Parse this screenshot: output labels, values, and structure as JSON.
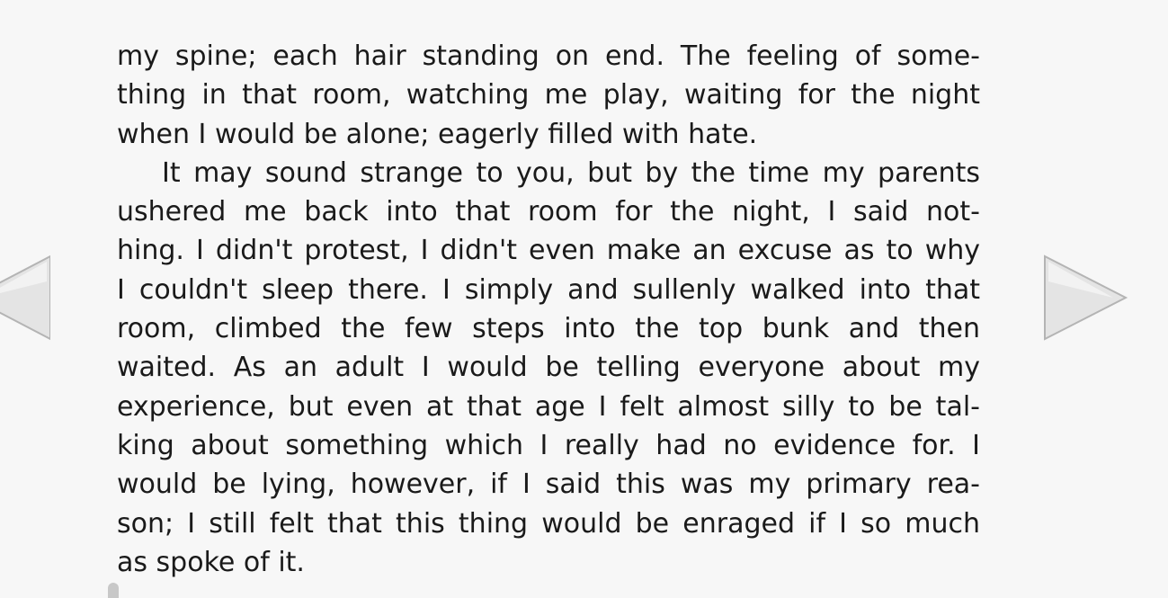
{
  "page": {
    "lines": [
      "my spine; each hair standing on end. The feeling of some-",
      "thing in that room, watching me play, waiting for the night",
      "when I would be alone; eagerly filled with hate.",
      "It may sound strange to you, but by the time my parents",
      "ushered me back into that room for the night, I said not-",
      "hing. I didn't protest, I didn't even make an excuse as to why",
      "I couldn't sleep there. I simply and sullenly walked into that",
      "room, climbed the few steps into the top bunk and then",
      "waited. As an adult I would be telling everyone about my",
      "experience, but even at that age I felt almost silly to be tal-",
      "king about something which I really had no evidence for. I",
      "would be lying, however, if I said this was my primary rea-",
      "son; I still felt that this thing would be enraged if I so much",
      "as spoke of it."
    ]
  },
  "navigation": {
    "prev_icon": "triangle-left-icon",
    "next_icon": "triangle-right-icon",
    "arrow_fill": "#e4e4e4",
    "arrow_stroke": "#b4b4b4"
  },
  "colors": {
    "background": "#f7f7f7",
    "text": "#1a1a1a"
  }
}
